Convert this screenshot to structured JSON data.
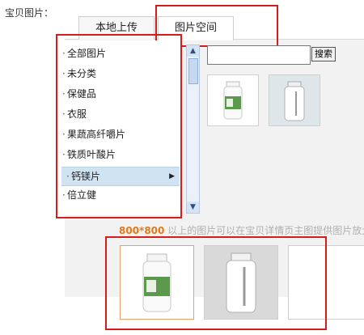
{
  "field": {
    "label": "宝贝图片："
  },
  "tabs": [
    {
      "label": "本地上传",
      "active": false
    },
    {
      "label": "图片空间",
      "active": true
    }
  ],
  "categories": [
    {
      "label": "全部图片"
    },
    {
      "label": "未分类"
    },
    {
      "label": "保健品"
    },
    {
      "label": "衣服"
    },
    {
      "label": "果蔬高纤嚼片"
    },
    {
      "label": "铁质叶酸片"
    },
    {
      "label": "钙镁片",
      "selected": true,
      "has_submenu": true
    },
    {
      "label": "倍立健"
    }
  ],
  "search": {
    "value": "",
    "button_label": "搜索"
  },
  "hint": {
    "size": "800*800",
    "text": " 以上的图片可以在宝贝详情页主图提供图片放大"
  },
  "icons": {
    "bullet": "·",
    "submenu_arrow": "▶",
    "scroll_up": "▲",
    "scroll_down": "▼"
  },
  "colors": {
    "highlight_red": "#d71c1c",
    "hint_orange": "#e27a1a",
    "selected_bg": "#cfe3f3"
  }
}
